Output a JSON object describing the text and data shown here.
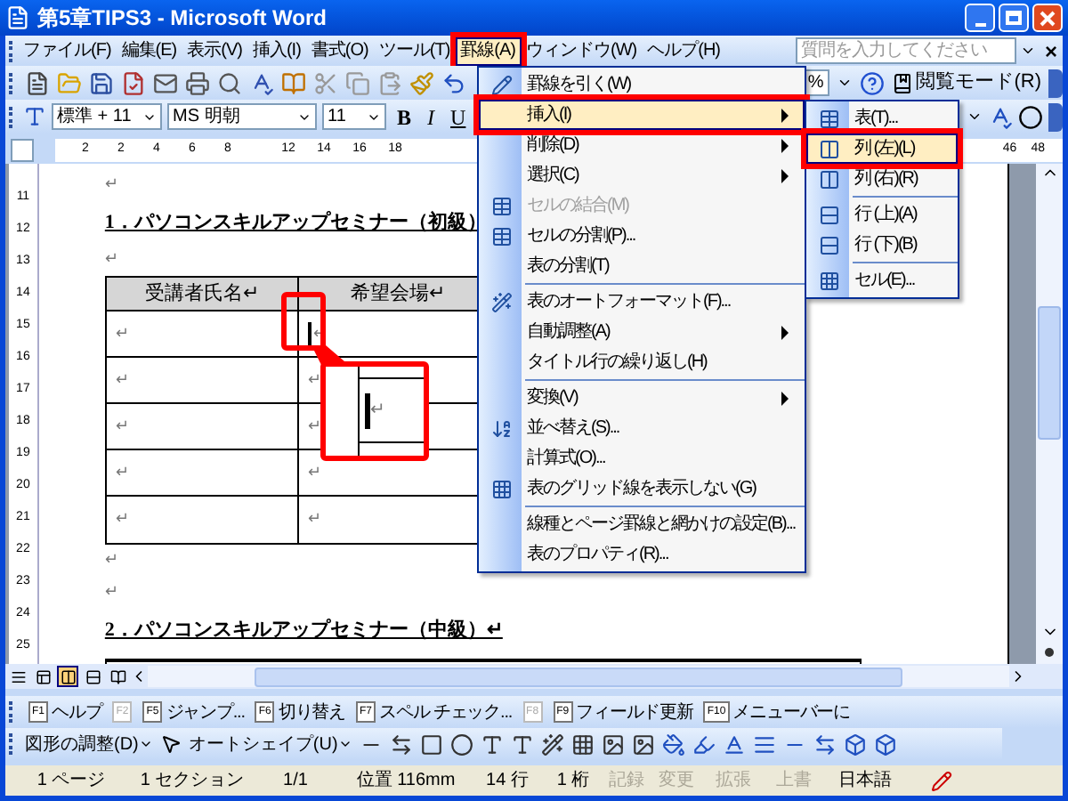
{
  "window": {
    "title": "第5章TIPS3 - Microsoft Word"
  },
  "menu_bar": {
    "items": [
      {
        "label": "ファイル(F)",
        "selected": false,
        "annotated": false
      },
      {
        "label": "編集(E)",
        "selected": false,
        "annotated": false
      },
      {
        "label": "表示(V)",
        "selected": false,
        "annotated": false
      },
      {
        "label": "挿入(I)",
        "selected": false,
        "annotated": false
      },
      {
        "label": "書式(O)",
        "selected": false,
        "annotated": false
      },
      {
        "label": "ツール(T)",
        "selected": false,
        "annotated": false
      },
      {
        "label": "罫線(A)",
        "selected": true,
        "annotated": true
      },
      {
        "label": "ウィンドウ(W)",
        "selected": false,
        "annotated": false
      },
      {
        "label": "ヘルプ(H)",
        "selected": false,
        "annotated": false
      }
    ],
    "search": {
      "placeholder": "質問を入力してください"
    },
    "close": "×"
  },
  "standard_toolbar": {
    "zoom": "%",
    "reading_mode": "閲覧モード(R)"
  },
  "formatting_toolbar": {
    "style": "標準 + 11",
    "font": "MS 明朝",
    "size": "11",
    "bold": "B",
    "italic": "I",
    "underline": "U"
  },
  "ruler": {
    "top_marks": [
      "2",
      "2",
      "4",
      "6",
      "8",
      "12",
      "14",
      "16",
      "18"
    ],
    "right_marks": [
      "46",
      "48"
    ],
    "side_marks": [
      "11",
      "12",
      "13",
      "14",
      "15",
      "16",
      "17",
      "18",
      "19",
      "20",
      "21",
      "22",
      "23",
      "24",
      "25"
    ]
  },
  "document": {
    "blocks": [
      {
        "kind": "mark",
        "text": "↵"
      },
      {
        "kind": "heading",
        "text": "1．パソコンスキルアップセミナー（初級）"
      },
      {
        "kind": "mark",
        "text": "↵"
      },
      {
        "kind": "table",
        "columns": [
          "受講者氏名↵",
          "希望会場↵"
        ],
        "rows": [
          [
            {
              "text": "↵",
              "cursor": false
            },
            {
              "text": "↵",
              "cursor": true
            }
          ],
          [
            {
              "text": "↵",
              "cursor": false
            },
            {
              "text": "↵",
              "cursor": false
            }
          ],
          [
            {
              "text": "↵",
              "cursor": false
            },
            {
              "text": "↵",
              "cursor": false
            }
          ],
          [
            {
              "text": "↵",
              "cursor": false
            },
            {
              "text": "↵",
              "cursor": false
            }
          ],
          [
            {
              "text": "↵",
              "cursor": false
            },
            {
              "text": "↵",
              "cursor": false
            }
          ]
        ]
      },
      {
        "kind": "mark",
        "text": "↵"
      },
      {
        "kind": "mark",
        "text": "↵"
      },
      {
        "kind": "heading",
        "text": "2．パソコンスキルアップセミナー（中級）↵"
      },
      {
        "kind": "table_edge"
      }
    ]
  },
  "callout": {
    "mark": "↵"
  },
  "table_menu": {
    "items": [
      {
        "kind": "item",
        "label": "罫線を引く(W)",
        "selected": false,
        "disabled": false,
        "submenu": false,
        "annotated": false
      },
      {
        "kind": "item",
        "label": "挿入(I)",
        "selected": true,
        "disabled": false,
        "submenu": true,
        "annotated": true
      },
      {
        "kind": "item",
        "label": "削除(D)",
        "selected": false,
        "disabled": false,
        "submenu": true,
        "annotated": false
      },
      {
        "kind": "item",
        "label": "選択(C)",
        "selected": false,
        "disabled": false,
        "submenu": true,
        "annotated": false
      },
      {
        "kind": "item",
        "label": "セルの結合(M)",
        "selected": false,
        "disabled": true,
        "submenu": false,
        "annotated": false
      },
      {
        "kind": "item",
        "label": "セルの分割(P)...",
        "selected": false,
        "disabled": false,
        "submenu": false,
        "annotated": false
      },
      {
        "kind": "item",
        "label": "表の分割(T)",
        "selected": false,
        "disabled": false,
        "submenu": false,
        "annotated": false
      },
      {
        "kind": "separator"
      },
      {
        "kind": "item",
        "label": "表のオートフォーマット(F)...",
        "selected": false,
        "disabled": false,
        "submenu": false,
        "annotated": false
      },
      {
        "kind": "item",
        "label": "自動調整(A)",
        "selected": false,
        "disabled": false,
        "submenu": true,
        "annotated": false
      },
      {
        "kind": "item",
        "label": "タイトル行の繰り返し(H)",
        "selected": false,
        "disabled": false,
        "submenu": false,
        "annotated": false
      },
      {
        "kind": "separator"
      },
      {
        "kind": "item",
        "label": "変換(V)",
        "selected": false,
        "disabled": false,
        "submenu": true,
        "annotated": false
      },
      {
        "kind": "item",
        "label": "並べ替え(S)...",
        "selected": false,
        "disabled": false,
        "submenu": false,
        "annotated": false
      },
      {
        "kind": "item",
        "label": "計算式(O)...",
        "selected": false,
        "disabled": false,
        "submenu": false,
        "annotated": false
      },
      {
        "kind": "item",
        "label": "表のグリッド線を表示しない(G)",
        "selected": false,
        "disabled": false,
        "submenu": false,
        "annotated": false
      },
      {
        "kind": "separator"
      },
      {
        "kind": "item",
        "label": "線種とページ罫線と網かけの設定(B)...",
        "selected": false,
        "disabled": false,
        "submenu": false,
        "annotated": false
      },
      {
        "kind": "item",
        "label": "表のプロパティ(R)...",
        "selected": false,
        "disabled": false,
        "submenu": false,
        "annotated": false
      }
    ]
  },
  "insert_submenu": {
    "items": [
      {
        "kind": "item",
        "label": "表(T)...",
        "selected": false,
        "annotated": false
      },
      {
        "kind": "item",
        "label": "列 (左)(L)",
        "selected": true,
        "annotated": true
      },
      {
        "kind": "item",
        "label": "列 (右)(R)",
        "selected": false,
        "annotated": false
      },
      {
        "kind": "separator"
      },
      {
        "kind": "item",
        "label": "行 (上)(A)",
        "selected": false,
        "annotated": false
      },
      {
        "kind": "item",
        "label": "行 (下)(B)",
        "selected": false,
        "annotated": false
      },
      {
        "kind": "separator"
      },
      {
        "kind": "item",
        "label": "セル(E)...",
        "selected": false,
        "annotated": false
      }
    ]
  },
  "view_buttons": [
    {
      "selected": false
    },
    {
      "selected": false
    },
    {
      "selected": true
    },
    {
      "selected": false
    },
    {
      "selected": false
    }
  ],
  "function_keys": [
    {
      "key": "F1",
      "label": "ヘルプ",
      "disabled": false
    },
    {
      "key": "F2",
      "disabled": true
    },
    {
      "key": "F5",
      "label": "ジャンプ...",
      "disabled": false
    },
    {
      "key": "F6",
      "label": "切り替え",
      "disabled": false
    },
    {
      "key": "F7",
      "label": "スペル チェック...",
      "disabled": false
    },
    {
      "key": "F8",
      "disabled": true
    },
    {
      "key": "F9",
      "label": "フィールド更新",
      "disabled": false
    },
    {
      "key": "F10",
      "label": "メニューバーに",
      "disabled": false
    }
  ],
  "drawing_toolbar": {
    "adjust": "図形の調整(D)",
    "autoshape": "オートシェイプ(U)"
  },
  "status_bar": {
    "items": [
      {
        "text": "1 ページ",
        "disabled": false
      },
      {
        "text": "1 セクション",
        "disabled": false
      },
      {
        "text": "1/1",
        "disabled": false
      },
      {
        "text": "位置 116mm",
        "disabled": false
      },
      {
        "text": "14 行",
        "disabled": false
      },
      {
        "text": "1 桁",
        "disabled": false
      },
      {
        "text": "記録",
        "disabled": true
      },
      {
        "text": "変更",
        "disabled": true
      },
      {
        "text": "拡張",
        "disabled": true
      },
      {
        "text": "上書",
        "disabled": true
      },
      {
        "text": "日本語",
        "disabled": false
      }
    ]
  }
}
